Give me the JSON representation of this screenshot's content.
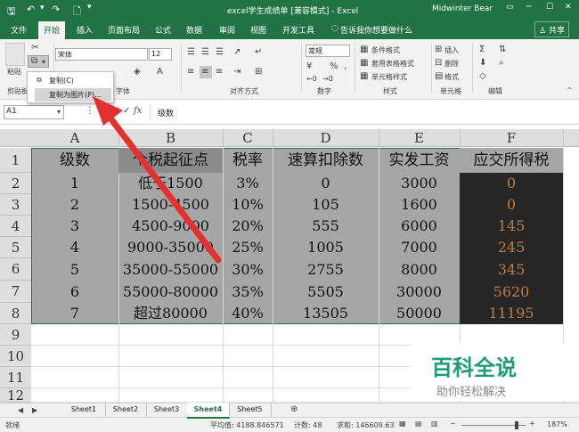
{
  "window": {
    "title": "excel学生成绩单 [兼容模式] - Excel",
    "user": "Midwinter Bear"
  },
  "tabs": [
    "文件",
    "开始",
    "插入",
    "页面布局",
    "公式",
    "数据",
    "审阅",
    "视图",
    "开发工具"
  ],
  "tell_me": "告诉我你想要做什么",
  "share": "共享",
  "ribbon": {
    "paste": "粘贴",
    "font_name": "宋体",
    "font_size": "12",
    "number_format": "常规",
    "groups": {
      "clipboard": "剪贴板",
      "font": "字体",
      "alignment": "对齐方式",
      "number": "数字",
      "styles": "样式",
      "cells": "单元格",
      "editing": "编辑"
    },
    "styles": [
      "条件格式",
      "套用表格格式",
      "单元格样式"
    ],
    "cells": [
      "插入",
      "删除",
      "格式"
    ],
    "pct": "%",
    "comma": ","
  },
  "dropdown": {
    "items": [
      "复制(C)",
      "复制为图片(P)..."
    ]
  },
  "formula_bar": {
    "name_box": "A1",
    "fx": "fx",
    "value": "级数"
  },
  "columns": [
    "A",
    "B",
    "C",
    "D",
    "E",
    "F"
  ],
  "rows": [
    "1",
    "2",
    "3",
    "4",
    "5",
    "6",
    "7",
    "8",
    "9",
    "10",
    "11",
    "12"
  ],
  "table": {
    "header": [
      "级数",
      "个税起征点",
      "税率",
      "速算扣除数",
      "实发工资",
      "应交所得税"
    ],
    "rows": [
      [
        "1",
        "低于1500",
        "3%",
        "0",
        "3000",
        "0"
      ],
      [
        "2",
        "1500-4500",
        "10%",
        "105",
        "1600",
        "0"
      ],
      [
        "3",
        "4500-9000",
        "20%",
        "555",
        "6000",
        "145"
      ],
      [
        "4",
        "9000-35000",
        "25%",
        "1005",
        "7000",
        "245"
      ],
      [
        "5",
        "35000-55000",
        "30%",
        "2755",
        "8000",
        "345"
      ],
      [
        "6",
        "55000-80000",
        "35%",
        "5505",
        "30000",
        "5620"
      ],
      [
        "7",
        "超过80000",
        "40%",
        "13505",
        "50000",
        "11195"
      ]
    ]
  },
  "sheets": [
    "Sheet1",
    "Sheet2",
    "Sheet3",
    "Sheet4",
    "Sheet5"
  ],
  "active_sheet": "Sheet4",
  "status": {
    "mode": "就绪",
    "average": "平均值: 4188.846571",
    "count": "计数: 48",
    "sum": "求和: 146609.63",
    "zoom": "187%"
  },
  "watermark": {
    "title": "百科全说",
    "subtitle": "助你轻松解决"
  },
  "colors": {
    "excel_green": "#217346",
    "selection": "#a6a6a6",
    "dark_col": "#262626",
    "orange_text": "#c47a3a"
  }
}
